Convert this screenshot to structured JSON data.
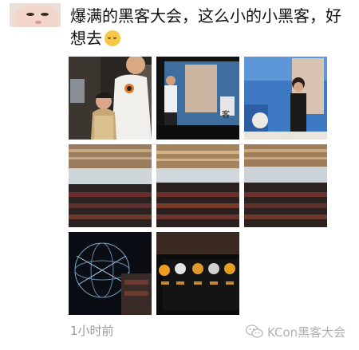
{
  "post": {
    "text": "爆满的黑客大会，这么小的小黑客，好想去",
    "emoji_icon": "weary-face-emoji",
    "timestamp": "1小时前"
  },
  "author": {
    "avatar_icon": "baby-avatar"
  },
  "photos": [
    {
      "name": "man-and-boy-photo"
    },
    {
      "name": "speaker-on-stage-photo-1"
    },
    {
      "name": "speaker-on-stage-photo-2"
    },
    {
      "name": "conference-hall-photo-1"
    },
    {
      "name": "conference-hall-photo-2"
    },
    {
      "name": "conference-hall-photo-3"
    },
    {
      "name": "globe-network-slide-photo"
    },
    {
      "name": "speaker-lineup-slide-photo"
    }
  ],
  "watermark": {
    "icon": "wechat-icon",
    "text": "KCon黑客大会"
  },
  "colors": {
    "text": "#111111",
    "timestamp": "#9a9a9a",
    "watermark": "#b0b0b0"
  }
}
